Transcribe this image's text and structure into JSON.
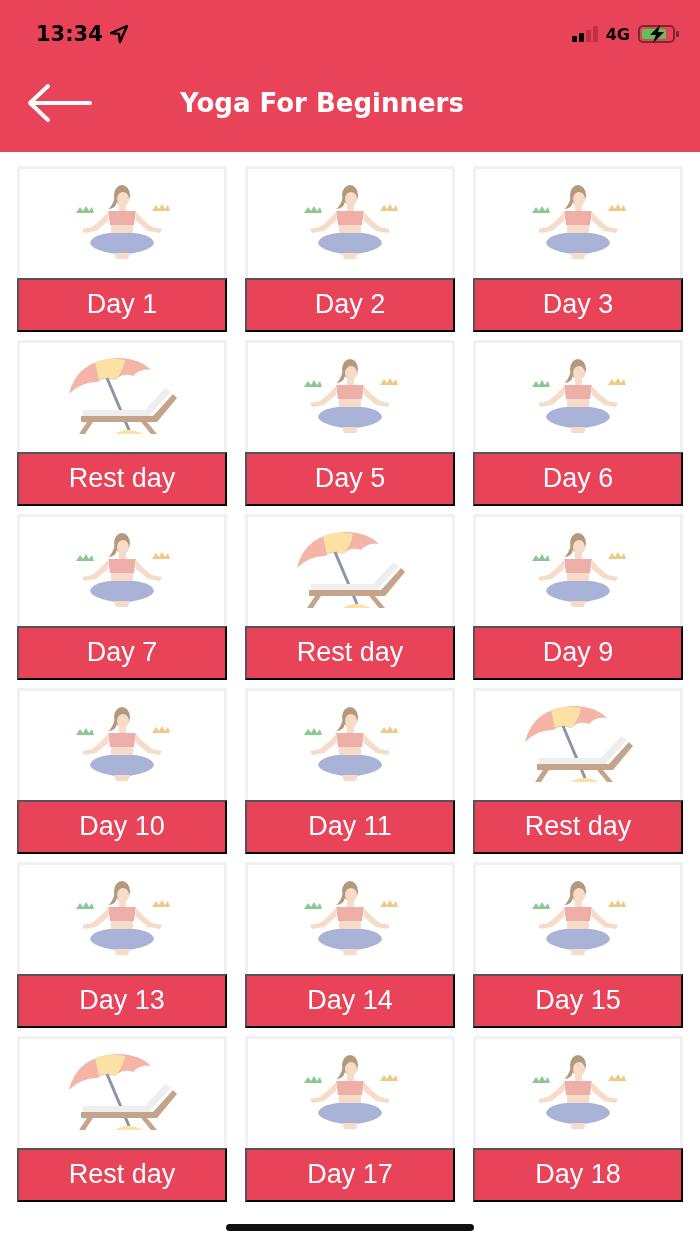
{
  "status_bar": {
    "time": "13:34",
    "network": "4G"
  },
  "header": {
    "title": "Yoga For Beginners"
  },
  "days": [
    {
      "label": "Day 1",
      "kind": "yoga"
    },
    {
      "label": "Day 2",
      "kind": "yoga"
    },
    {
      "label": "Day 3",
      "kind": "yoga"
    },
    {
      "label": "Rest day",
      "kind": "rest"
    },
    {
      "label": "Day 5",
      "kind": "yoga"
    },
    {
      "label": "Day 6",
      "kind": "yoga"
    },
    {
      "label": "Day 7",
      "kind": "yoga"
    },
    {
      "label": "Rest day",
      "kind": "rest"
    },
    {
      "label": "Day 9",
      "kind": "yoga"
    },
    {
      "label": "Day 10",
      "kind": "yoga"
    },
    {
      "label": "Day 11",
      "kind": "yoga"
    },
    {
      "label": "Rest day",
      "kind": "rest"
    },
    {
      "label": "Day 13",
      "kind": "yoga"
    },
    {
      "label": "Day 14",
      "kind": "yoga"
    },
    {
      "label": "Day 15",
      "kind": "yoga"
    },
    {
      "label": "Rest day",
      "kind": "rest"
    },
    {
      "label": "Day 17",
      "kind": "yoga"
    },
    {
      "label": "Day 18",
      "kind": "yoga"
    }
  ]
}
